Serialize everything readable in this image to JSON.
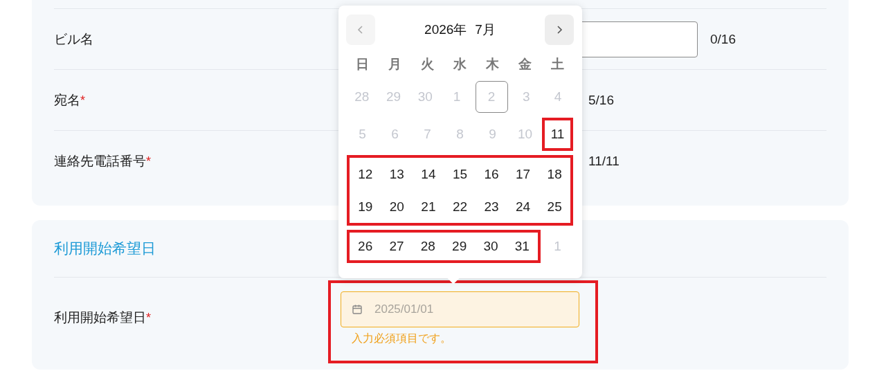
{
  "contact_card": {
    "rows": [
      {
        "label": "ビル名",
        "kind": "wide",
        "counter": "0/16"
      },
      {
        "label": "宛名",
        "required_mark": "*",
        "kind": "narrow",
        "counter": "5/16"
      },
      {
        "label": "連絡先電話番号",
        "required_mark": "*",
        "kind": "narrow",
        "counter": "11/11"
      }
    ]
  },
  "date_card": {
    "title": "利用開始希望日",
    "label": "利用開始希望日",
    "required_mark": "*",
    "placeholder": "2025/01/01",
    "error": "入力必須項目です。",
    "marked": true
  },
  "calendar": {
    "year_label": "2026年",
    "month_label": "7月",
    "prev_disabled": true,
    "next_disabled": false,
    "weekdays": [
      "日",
      "月",
      "火",
      "水",
      "木",
      "金",
      "土"
    ],
    "weeks": [
      {
        "segments": [
          {
            "marked": false,
            "days": [
              {
                "day": "28",
                "outside": true,
                "today": false
              },
              {
                "day": "29",
                "outside": true,
                "today": false
              },
              {
                "day": "30",
                "outside": true,
                "today": false
              },
              {
                "day": "1",
                "outside": true,
                "today": false
              },
              {
                "day": "2",
                "outside": true,
                "today": true
              },
              {
                "day": "3",
                "outside": true,
                "today": false
              },
              {
                "day": "4",
                "outside": true,
                "today": false
              }
            ]
          }
        ]
      },
      {
        "segments": [
          {
            "marked": false,
            "days": [
              {
                "day": "5",
                "outside": true,
                "today": false
              },
              {
                "day": "6",
                "outside": true,
                "today": false
              },
              {
                "day": "7",
                "outside": true,
                "today": false
              },
              {
                "day": "8",
                "outside": true,
                "today": false
              },
              {
                "day": "9",
                "outside": true,
                "today": false
              },
              {
                "day": "10",
                "outside": true,
                "today": false
              }
            ]
          },
          {
            "marked": true,
            "days": [
              {
                "day": "11",
                "outside": false,
                "today": false
              }
            ]
          }
        ]
      },
      {
        "segments": [
          {
            "marked": true,
            "days": [
              {
                "day": "12",
                "outside": false,
                "today": false
              },
              {
                "day": "13",
                "outside": false,
                "today": false
              },
              {
                "day": "14",
                "outside": false,
                "today": false
              },
              {
                "day": "15",
                "outside": false,
                "today": false
              },
              {
                "day": "16",
                "outside": false,
                "today": false
              },
              {
                "day": "17",
                "outside": false,
                "today": false
              },
              {
                "day": "18",
                "outside": false,
                "today": false
              }
            ]
          }
        ]
      },
      {
        "segments": [
          {
            "marked": true,
            "days": [
              {
                "day": "19",
                "outside": false,
                "today": false
              },
              {
                "day": "20",
                "outside": false,
                "today": false
              },
              {
                "day": "21",
                "outside": false,
                "today": false
              },
              {
                "day": "22",
                "outside": false,
                "today": false
              },
              {
                "day": "23",
                "outside": false,
                "today": false
              },
              {
                "day": "24",
                "outside": false,
                "today": false
              },
              {
                "day": "25",
                "outside": false,
                "today": false
              }
            ]
          }
        ]
      },
      {
        "segments": [
          {
            "marked": true,
            "days": [
              {
                "day": "26",
                "outside": false,
                "today": false
              },
              {
                "day": "27",
                "outside": false,
                "today": false
              },
              {
                "day": "28",
                "outside": false,
                "today": false
              },
              {
                "day": "29",
                "outside": false,
                "today": false
              },
              {
                "day": "30",
                "outside": false,
                "today": false
              },
              {
                "day": "31",
                "outside": false,
                "today": false
              }
            ]
          },
          {
            "marked": false,
            "days": [
              {
                "day": "1",
                "outside": true,
                "today": false
              }
            ]
          }
        ]
      }
    ]
  }
}
